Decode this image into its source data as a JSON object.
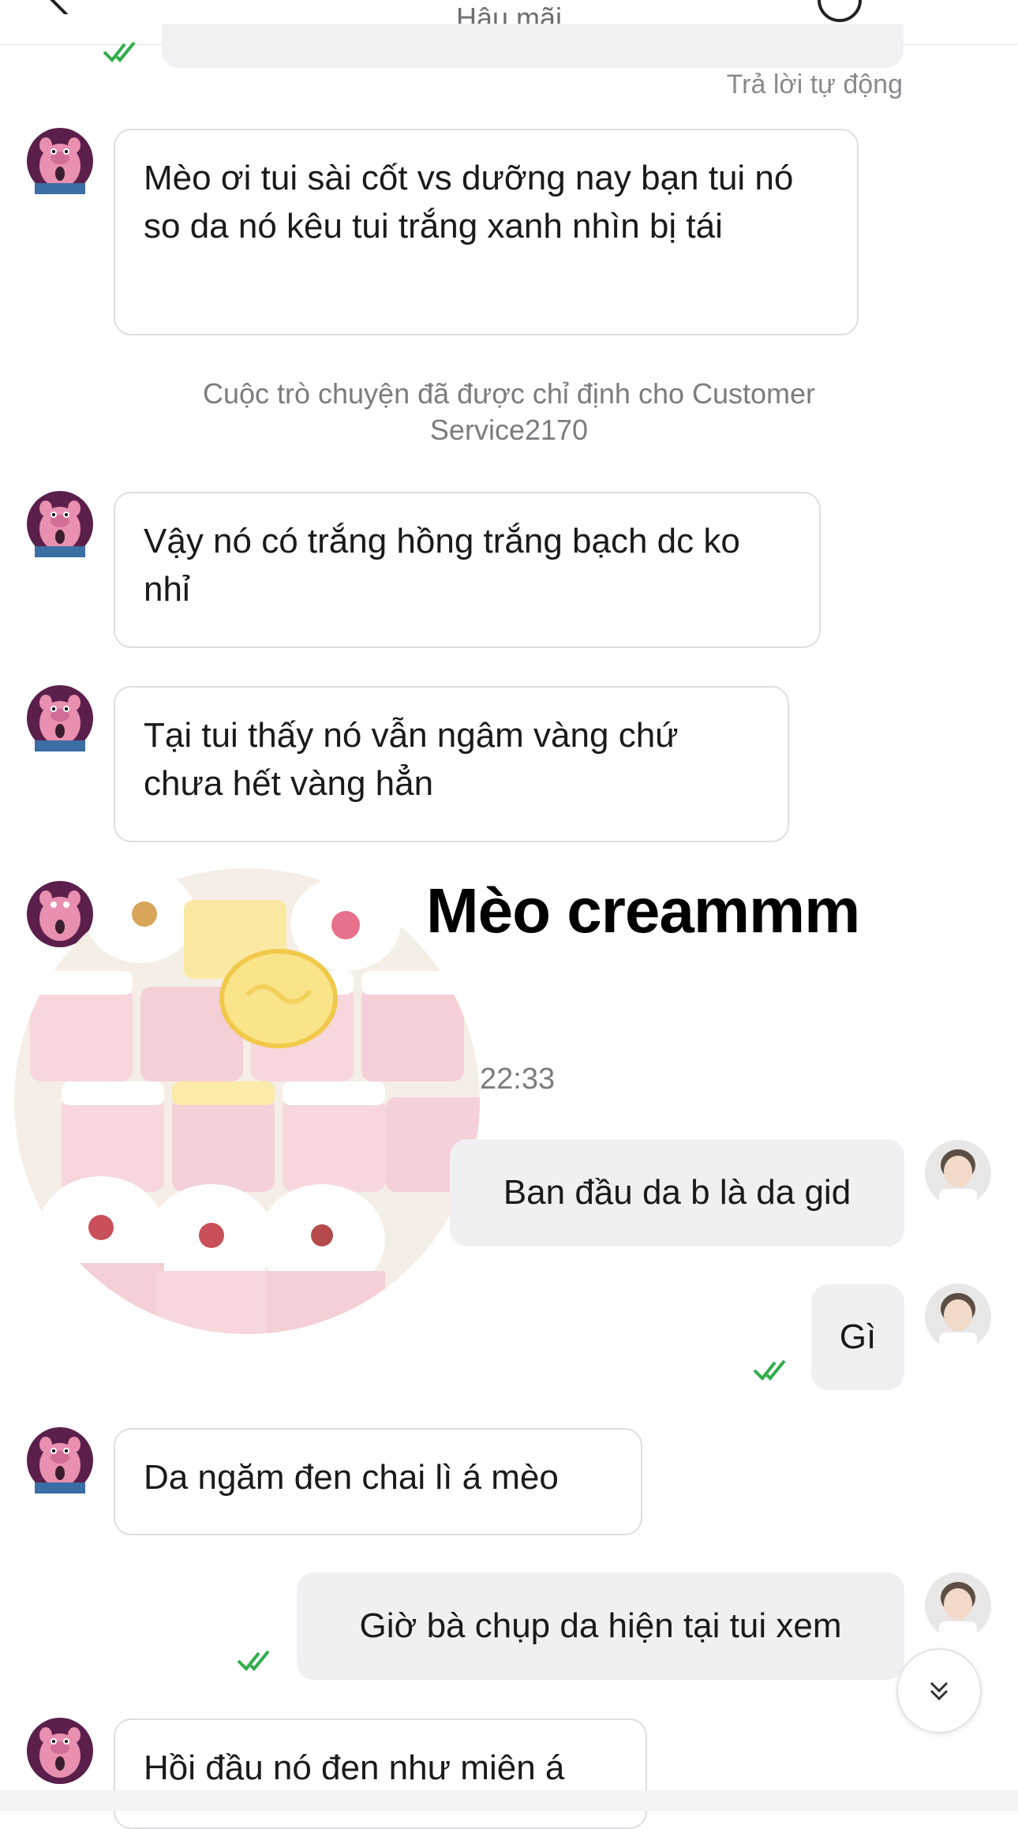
{
  "header": {
    "title": "Hậu mãi"
  },
  "auto_reply_label": "Trả lời tự động",
  "system_note": "Cuộc trò chuyện đã được chỉ định cho Customer Service2170",
  "messages_in": [
    "Mèo ơi tui sài cốt vs dưỡng nay bạn tui nó so da nó kêu tui trắng xanh nhìn bị tái",
    "Vậy nó có trắng hồng trắng bạch dc ko nhỉ",
    "Tại tui thấy nó vẫn ngâm vàng chứ chưa hết vàng hẳn",
    "Da ngăm đen chai lì á mèo",
    "Hồi đầu nó đen như miên á"
  ],
  "messages_out": [
    "Ban đầu da b là da gid",
    "Gì",
    "Giờ bà chụp da hiện tại tui xem"
  ],
  "timestamp": "22:33",
  "overlay": {
    "title": "Mèo creammm"
  },
  "colors": {
    "read_check": "#2fae4a",
    "avatar_pink": "#e98fb0",
    "avatar_dark": "#5a1f4a"
  },
  "icons": {
    "back": "chevron-left-icon",
    "scroll_down": "double-chevron-down-icon",
    "read_receipt": "double-check-icon"
  }
}
